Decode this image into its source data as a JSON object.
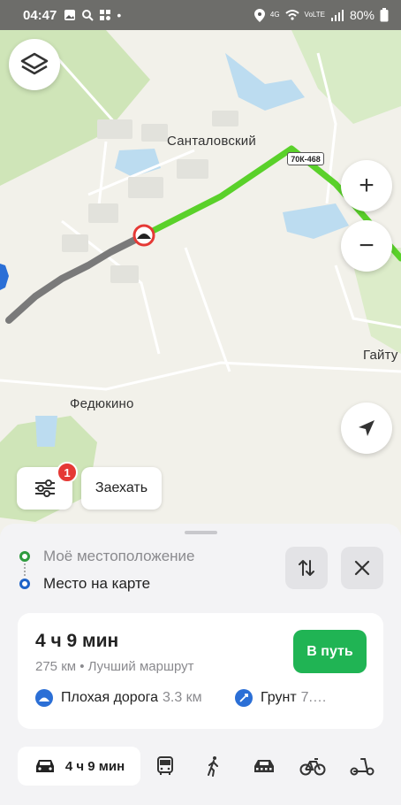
{
  "status_bar": {
    "time": "04:47",
    "network_4g": "4G",
    "network_lte": "VoLTE",
    "battery": "80%"
  },
  "map": {
    "labels": {
      "village_1": "Санталовский",
      "village_2": "Федюкино",
      "village_3": "Гайту"
    },
    "road_badge": "70К-468",
    "route_colors": {
      "fast": "#5ad12a",
      "slow": "#7a7a7a"
    }
  },
  "controls": {
    "layers_icon": "layers-icon",
    "zoom_in": "+",
    "zoom_out": "−",
    "filter_badge": "1",
    "stopover_button": "Заехать"
  },
  "route": {
    "from": "Моё местоположение",
    "to": "Место на карте"
  },
  "summary": {
    "duration": "4 ч 9 мин",
    "details": "275 км • Лучший маршрут",
    "go_button": "В путь",
    "warnings": [
      {
        "label": "Плохая дорога",
        "value": "3.3 км"
      },
      {
        "label": "Грунт",
        "value": "7.…"
      }
    ]
  },
  "modes": {
    "car": "4 ч 9 мин"
  },
  "colors": {
    "accent_green": "#20b454",
    "origin_dot": "#2e9b3e",
    "destination_dot": "#1e63c8"
  }
}
